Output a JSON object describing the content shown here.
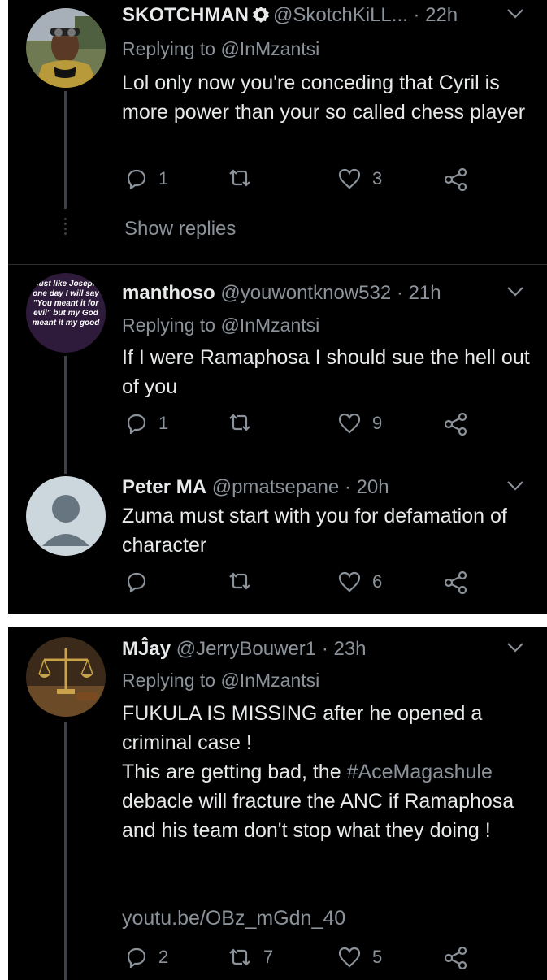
{
  "colors": {
    "background": "#000000",
    "text": "#e7e9ea",
    "muted": "#8b9299",
    "separator": "#ffffff"
  },
  "tweets": [
    {
      "name": "SKOTCHMAN",
      "verified_icon": "verified-badge-icon",
      "handle": "@SkotchKiLL...",
      "time": "· 22h",
      "replying": "Replying to @InMzantsi",
      "body": "Lol only now you're conceding that Cyril is more power than your so called chess player",
      "replies": "1",
      "retweets": "",
      "likes": "3",
      "show_replies": "Show replies"
    },
    {
      "name": "manthoso",
      "handle": "@youwontknow532",
      "time": "· 21h",
      "replying": "Replying to @InMzantsi",
      "avatar_text": "Just like Joseph one day I will say \"You meant it for evil\" but my God meant it my good",
      "body": "If I were Ramaphosa I  should sue the hell out of you",
      "replies": "1",
      "retweets": "",
      "likes": "9"
    },
    {
      "name": "Peter MA",
      "handle": "@pmatsepane",
      "time": "· 20h",
      "body": "Zuma must start with you for defamation of character",
      "replies": "",
      "retweets": "",
      "likes": "6"
    },
    {
      "name": "MĴay",
      "handle": "@JerryBouwer1",
      "time": "· 23h",
      "replying": "Replying to @InMzantsi",
      "body_line1": "FUKULA IS MISSING after he opened a criminal case !",
      "body_line2_pre": "This are getting bad, the ",
      "hashtag": "#AceMagashule",
      "body_line2_post": " debacle will fracture the ANC if Ramaphosa and his team don't stop what they doing !",
      "link": "youtu.be/OBz_mGdn_40",
      "replies": "2",
      "retweets": "7",
      "likes": "5"
    }
  ]
}
